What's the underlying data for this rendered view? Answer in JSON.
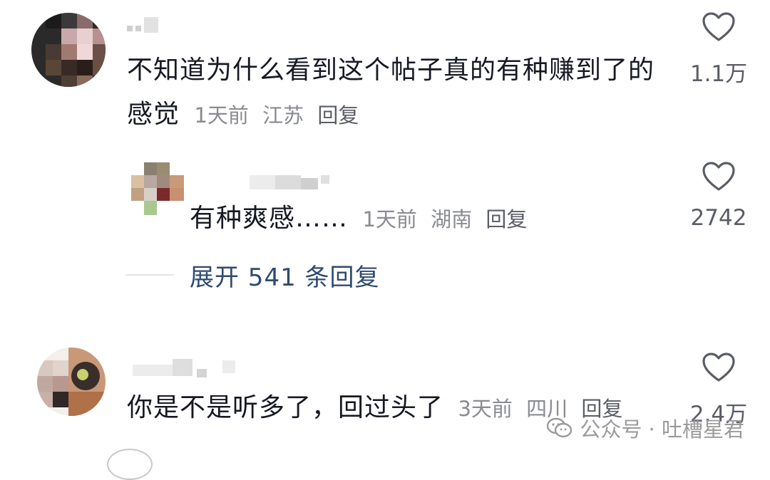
{
  "comments": [
    {
      "text": "不知道为什么看到这个帖子真的有种赚到了的感觉",
      "time": "1天前",
      "location": "江苏",
      "reply": "回复",
      "likes": "1.1万"
    },
    {
      "text": "有种爽感……",
      "time": "1天前",
      "location": "湖南",
      "reply": "回复",
      "likes": "2742"
    },
    {
      "text": "你是不是听多了，回过头了",
      "time": "3天前",
      "location": "四川",
      "reply": "回复",
      "likes": "2.4万"
    }
  ],
  "expand_replies": "展开 541 条回复",
  "watermark": "公众号 · 吐槽星君",
  "icons": {
    "like": "heart-outline-icon",
    "watermark": "wechat-icon"
  },
  "colors": {
    "text": "#161823",
    "meta": "#8a8b91",
    "expand": "#2e4a70"
  }
}
